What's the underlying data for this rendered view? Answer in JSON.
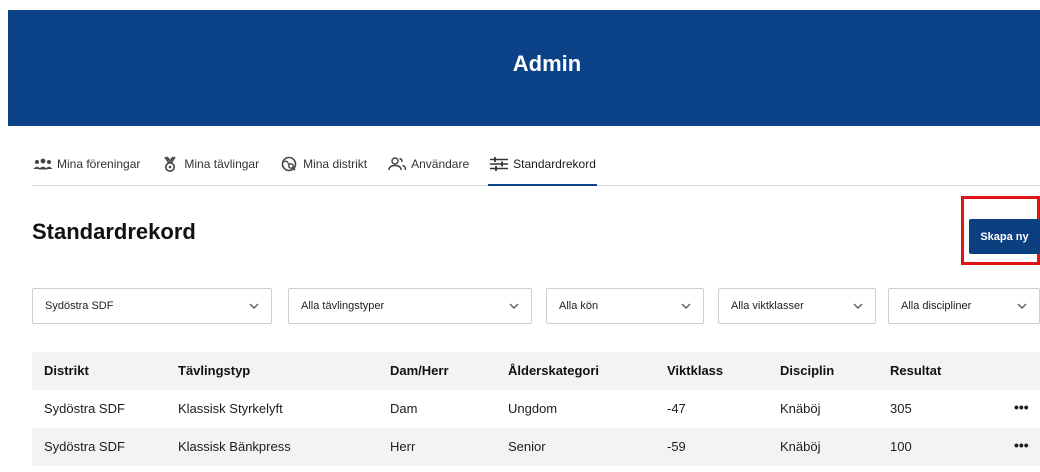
{
  "header": {
    "title": "Admin",
    "background": "#0b4288"
  },
  "tabs": [
    {
      "label": "Mina föreningar",
      "icon": "people-group-icon"
    },
    {
      "label": "Mina tävlingar",
      "icon": "medal-icon"
    },
    {
      "label": "Mina distrikt",
      "icon": "map-search-icon"
    },
    {
      "label": "Användare",
      "icon": "users-icon"
    },
    {
      "label": "Standardrekord",
      "icon": "sliders-icon",
      "active": true
    }
  ],
  "page": {
    "title": "Standardrekord",
    "create_label": "Skapa ny"
  },
  "filters": [
    {
      "value": "Sydöstra SDF"
    },
    {
      "value": "Alla tävlingstyper"
    },
    {
      "value": "Alla kön"
    },
    {
      "value": "Alla viktklasser"
    },
    {
      "value": "Alla discipliner"
    }
  ],
  "table": {
    "columns": [
      "Distrikt",
      "Tävlingstyp",
      "Dam/Herr",
      "Ålderskategori",
      "Viktklass",
      "Disciplin",
      "Resultat"
    ],
    "rows": [
      [
        "Sydöstra SDF",
        "Klassisk Styrkelyft",
        "Dam",
        "Ungdom",
        "-47",
        "Knäböj",
        "305"
      ],
      [
        "Sydöstra SDF",
        "Klassisk Bänkpress",
        "Herr",
        "Senior",
        "-59",
        "Knäböj",
        "100"
      ]
    ],
    "row_action": "•••"
  },
  "colors": {
    "accent": "#0b4288",
    "highlight": "#e01414",
    "row_alt": "#f3f3f3"
  }
}
